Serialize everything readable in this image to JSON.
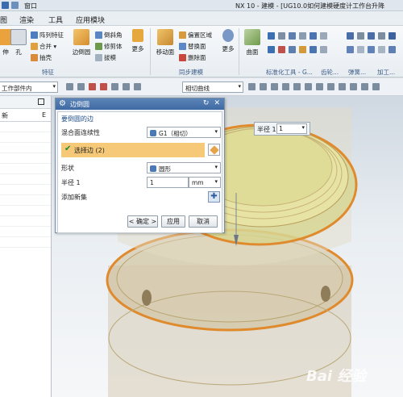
{
  "window": {
    "menu_label": "窗口",
    "title": "NX 10 - 建模 - [UG10.0如何建模硬度计工作台升降"
  },
  "menu_tabs": [
    "图",
    "渲染",
    "工具",
    "应用模块"
  ],
  "ribbon": {
    "big_buttons": [
      {
        "icon": "extrude-icon",
        "label": "伸"
      },
      {
        "icon": "hole-icon",
        "label": "孔"
      },
      {
        "icon": "edge-blend-icon",
        "label": "边倒圆"
      },
      {
        "icon": "more-icon",
        "label": "更多"
      },
      {
        "icon": "move-face-icon",
        "label": "移动面"
      },
      {
        "icon": "more-icon",
        "label": "更多"
      },
      {
        "icon": "surface-icon",
        "label": "曲面"
      }
    ],
    "feature_rows": [
      {
        "icon": "pattern-feature-icon",
        "label": "阵列特征"
      },
      {
        "icon": "unite-icon",
        "label": "合并 ▾"
      },
      {
        "icon": "shell-icon",
        "label": "抽壳"
      }
    ],
    "feature_rows2": [
      {
        "icon": "chamfer-icon",
        "label": "倒斜角"
      },
      {
        "icon": "trim-body-icon",
        "label": "修剪体"
      },
      {
        "icon": "draft-icon",
        "label": "拔模"
      }
    ],
    "sync_rows": [
      {
        "icon": "offset-region-icon",
        "label": "偏置区域"
      },
      {
        "icon": "replace-face-icon",
        "label": "替换面"
      },
      {
        "icon": "delete-face-icon",
        "label": "删除面"
      }
    ],
    "group_labels": [
      "特征",
      "同步建模",
      "标准化工具 - G...",
      "齿轮...",
      "弹簧...",
      "加工..."
    ]
  },
  "selection_bar": {
    "scope": "工作部件内",
    "curve_rule": "相切曲线"
  },
  "navigator": {
    "header": "新",
    "marker": "E"
  },
  "dialog": {
    "title": "边倒圆",
    "section": "要倒圆的边",
    "continuity_label": "混合面连续性",
    "continuity_value": "G1（相切）",
    "select_edge_label": "选择边 (2)",
    "shape_label": "形状",
    "shape_value": "圆形",
    "radius_label": "半径 1",
    "radius_value": "1",
    "radius_unit": "mm",
    "add_set_label": "添加新集",
    "ok_label": "< 确定 >",
    "apply_label": "应用",
    "cancel_label": "取消",
    "reset_glyph": "↻",
    "close_glyph": "✕",
    "add_glyph": "✚"
  },
  "float_field": {
    "label": "半径 1",
    "value": "1"
  },
  "watermark": "Bai 经验"
}
